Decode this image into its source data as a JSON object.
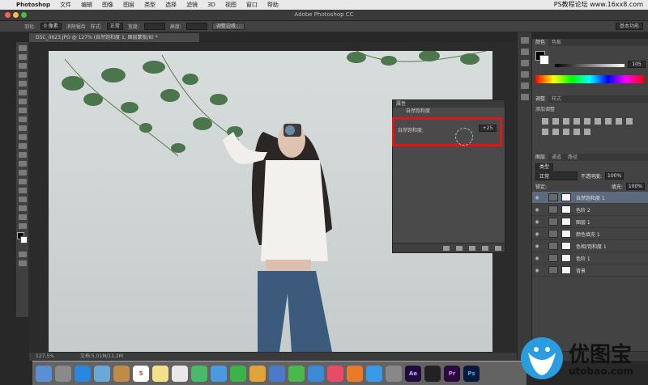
{
  "menubar": {
    "items": [
      "Photoshop",
      "文件",
      "编辑",
      "图像",
      "图层",
      "类型",
      "选择",
      "滤镜",
      "3D",
      "视图",
      "窗口",
      "帮助"
    ],
    "watermark": "PS教程论坛 www.16xx8.com"
  },
  "window": {
    "title": "Adobe Photoshop CC"
  },
  "options": {
    "feather_label": "羽化:",
    "feather_value": "0 像素",
    "antialias": "消除锯齿",
    "style_label": "样式:",
    "style_value": "正常",
    "width_label": "宽度:",
    "height_label": "高度:",
    "refine_button": "调整边缘...",
    "workspace": "基本功能"
  },
  "document": {
    "tab": "DSC_0623.JPG @ 127% (自然饱和度 1, 图层蒙版/8) *",
    "status_zoom": "127.5%",
    "status_doc": "文档:5.01M/11.2M"
  },
  "properties": {
    "header": "属性",
    "type_label": "自然饱和度",
    "vibrance_label": "自然饱和度:",
    "vibrance_value": "+25"
  },
  "panels": {
    "color_tabs": [
      "颜色",
      "色板"
    ],
    "color_value": "105",
    "adjust_tabs": [
      "调整",
      "样式"
    ],
    "adjust_header": "添加调整",
    "layers_tabs": [
      "图层",
      "通道",
      "路径"
    ],
    "kind_label": "类型",
    "blend_mode": "正常",
    "opacity_label": "不透明度:",
    "opacity_value": "100%",
    "lock_label": "锁定:",
    "fill_label": "填充:",
    "fill_value": "100%",
    "layers": [
      {
        "name": "自然饱和度 1",
        "selected": true
      },
      {
        "name": "色阶 2",
        "selected": false
      },
      {
        "name": "图层 1",
        "selected": false
      },
      {
        "name": "颜色填充 1",
        "selected": false
      },
      {
        "name": "色相/饱和度 1",
        "selected": false
      },
      {
        "name": "色阶 1",
        "selected": false
      },
      {
        "name": "背景",
        "selected": false
      }
    ]
  },
  "dock": {
    "apps": [
      "Ae",
      "Pr",
      "Ps"
    ],
    "calendar_day": "5"
  },
  "brand": {
    "name": "优图宝",
    "url": "utobao.com"
  }
}
